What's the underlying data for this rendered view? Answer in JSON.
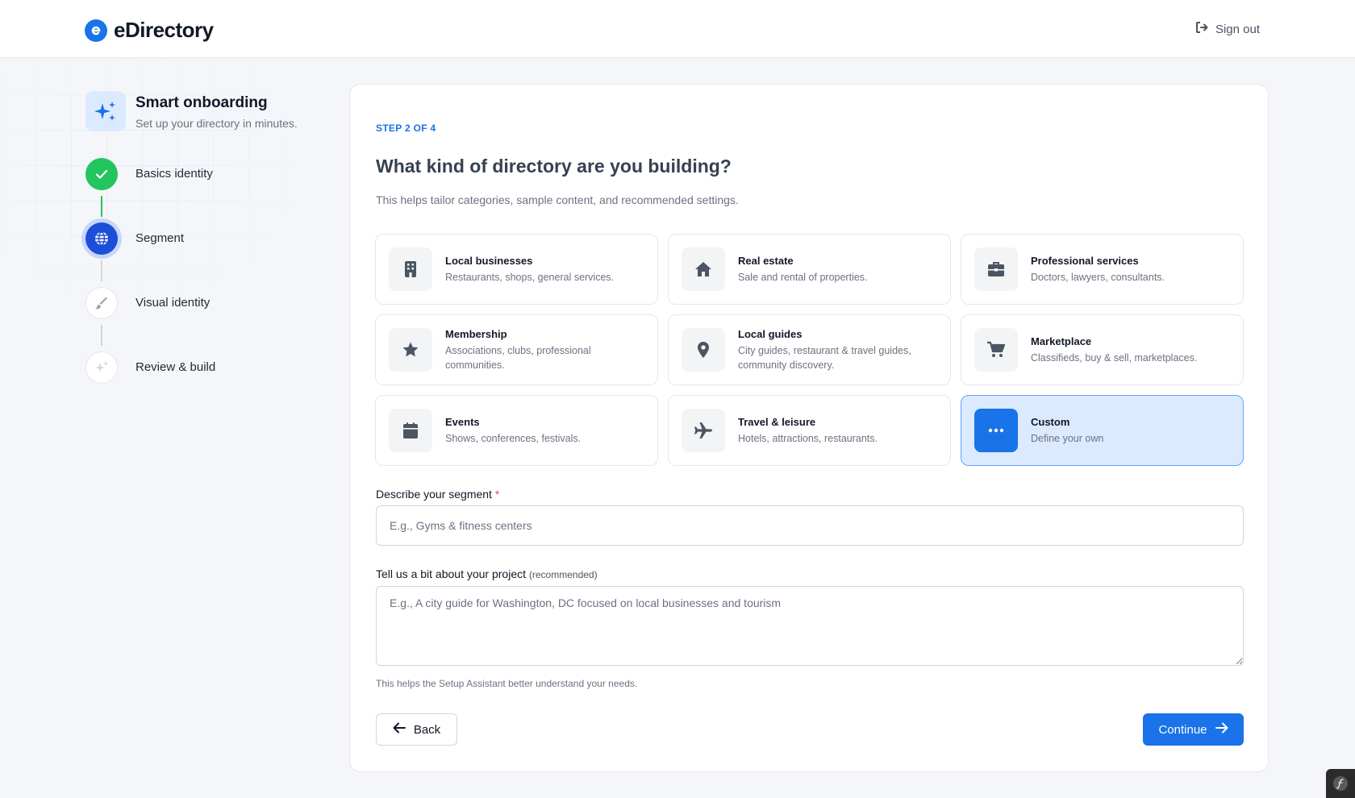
{
  "header": {
    "logo_text": "eDirectory",
    "signout_label": "Sign out"
  },
  "sidebar": {
    "title": "Smart onboarding",
    "subtitle": "Set up your directory in minutes.",
    "steps": [
      {
        "label": "Basics identity",
        "status": "done"
      },
      {
        "label": "Segment",
        "status": "active"
      },
      {
        "label": "Visual identity",
        "status": "pending"
      },
      {
        "label": "Review & build",
        "status": "pending"
      }
    ]
  },
  "main": {
    "eyebrow": "STEP 2 OF 4",
    "heading": "What kind of directory are you building?",
    "subtext": "This helps tailor categories, sample content, and recommended settings.",
    "options": [
      {
        "title": "Local businesses",
        "desc": "Restaurants, shops, general services.",
        "icon": "building-icon"
      },
      {
        "title": "Real estate",
        "desc": "Sale and rental of properties.",
        "icon": "house-icon"
      },
      {
        "title": "Professional services",
        "desc": "Doctors, lawyers, consultants.",
        "icon": "briefcase-icon"
      },
      {
        "title": "Membership",
        "desc": "Associations, clubs, professional communities.",
        "icon": "star-icon"
      },
      {
        "title": "Local guides",
        "desc": "City guides, restaurant & travel guides, community discovery.",
        "icon": "map-pin-icon"
      },
      {
        "title": "Marketplace",
        "desc": "Classifieds, buy & sell, marketplaces.",
        "icon": "cart-icon"
      },
      {
        "title": "Events",
        "desc": "Shows, conferences, festivals.",
        "icon": "calendar-icon"
      },
      {
        "title": "Travel & leisure",
        "desc": "Hotels, attractions, restaurants.",
        "icon": "plane-icon"
      },
      {
        "title": "Custom",
        "desc": "Define your own",
        "icon": "more-icon",
        "selected": true
      }
    ],
    "segment_label": "Describe your segment",
    "segment_required_mark": "*",
    "segment_placeholder": "E.g., Gyms & fitness centers",
    "project_label": "Tell us a bit about your project",
    "project_label_note": "(recommended)",
    "project_placeholder": "E.g., A city guide for Washington, DC focused on local businesses and tourism",
    "project_hint": "This helps the Setup Assistant better understand your needs.",
    "back_label": "Back",
    "continue_label": "Continue"
  },
  "colors": {
    "accent": "#1a73e8",
    "success": "#22c55e",
    "active_step": "#1d4ed8",
    "selected_bg": "#dbeafe"
  }
}
